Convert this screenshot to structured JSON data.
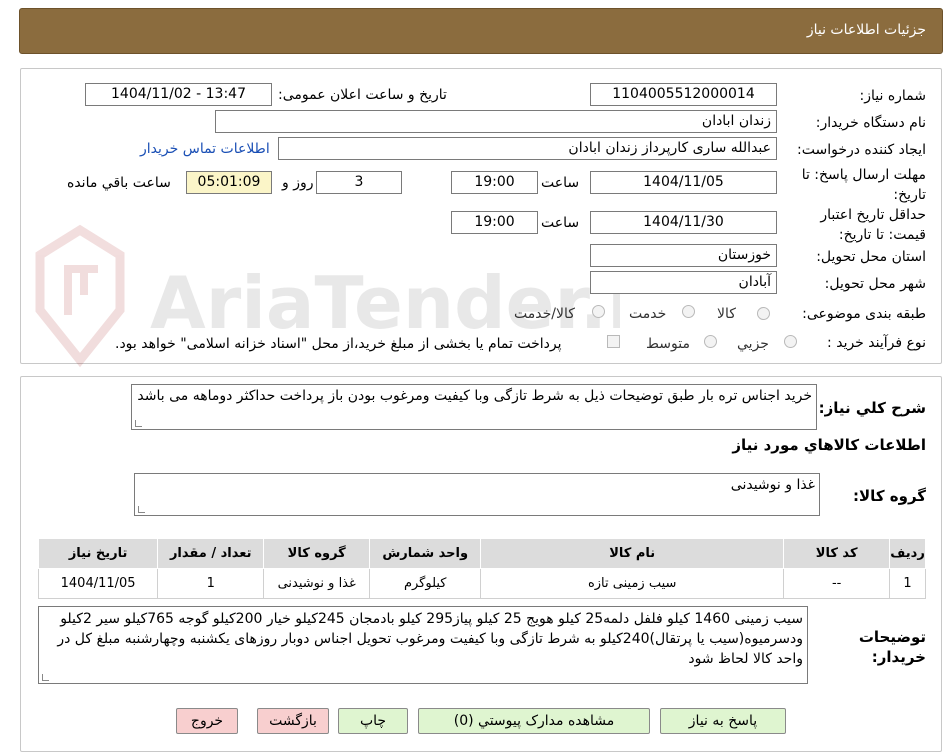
{
  "header": {
    "title": "جزئیات اطلاعات نیاز"
  },
  "watermark": {
    "text": "AriaTender.neT"
  },
  "form": {
    "need_number_label": "شماره نیاز:",
    "need_number": "1104005512000014",
    "announce_label": "تاریخ و ساعت اعلان عمومی:",
    "announce_value": "1404/11/02 - 13:47",
    "buyer_label": "نام دستگاه خریدار:",
    "buyer_value": "زندان ابادان",
    "creator_label": "ایجاد کننده درخواست:",
    "creator_value": "عبدالله ساری کارپرداز زندان ابادان",
    "contact_link": "اطلاعات تماس خریدار",
    "deadline_label": "مهلت ارسال پاسخ: تا تاریخ:",
    "deadline_date": "1404/11/05",
    "time_label": "ساعت",
    "deadline_time": "19:00",
    "days_value": "3",
    "days_label": "روز و",
    "remaining_time": "05:01:09",
    "remaining_label": "ساعت باقي مانده",
    "validity_label": "حداقل تاریخ اعتبار قیمت: تا تاریخ:",
    "validity_date": "1404/11/30",
    "validity_time": "19:00",
    "province_label": "استان محل تحویل:",
    "province_value": "خوزستان",
    "city_label": "شهر محل تحویل:",
    "city_value": "آبادان",
    "category_label": "طبقه بندی موضوعی:",
    "category_options": [
      "کالا",
      "خدمت",
      "کالا/خدمت"
    ],
    "process_label": "نوع فرآیند خرید :",
    "process_options": [
      "جزیي",
      "متوسط"
    ],
    "payment_note": "پرداخت تمام یا بخشی از مبلغ خرید،از محل \"اسناد خزانه اسلامی\" خواهد بود."
  },
  "summary": {
    "label": "شرح کلي نياز:",
    "text": "خرید اجناس تره بار طبق توضیحات ذیل به شرط تازگی وبا کیفیت ومرغوب بودن باز پرداخت حداکثر دوماهه می باشد",
    "items_heading": "اطلاعات کالاهاي مورد نياز",
    "group_label": "گروه کالا:",
    "group_value": "غذا و نوشیدنی"
  },
  "table": {
    "headers": [
      "ردیف",
      "کد کالا",
      "نام کالا",
      "واحد شمارش",
      "گروه کالا",
      "تعداد / مقدار",
      "تاریخ نیاز"
    ],
    "rows": [
      [
        "1",
        "--",
        "سیب زمینی تازه",
        "کیلوگرم",
        "غذا و نوشیدنی",
        "1",
        "1404/11/05"
      ]
    ]
  },
  "notes": {
    "label": "توضیحات خریدار:",
    "text": "سیب زمینی 1460 کیلو فلفل دلمه25 کیلو هویج 25 کیلو پیاز295 کیلو بادمجان 245کیلو خیار 200کیلو گوجه 765کیلو سیر 2کیلو ودسرمیوه(سیب یا پرتقال)240کیلو به شرط تازگی وبا کیفیت ومرغوب تحویل اجناس دوبار روزهای یکشنبه وچهارشنبه مبلغ کل در واحد کالا لحاظ شود"
  },
  "buttons": {
    "reply": "پاسخ به نیاز",
    "attachments": "مشاهده مدارک پیوستي (0)",
    "print": "چاپ",
    "back": "بازگشت",
    "exit": "خروج"
  }
}
